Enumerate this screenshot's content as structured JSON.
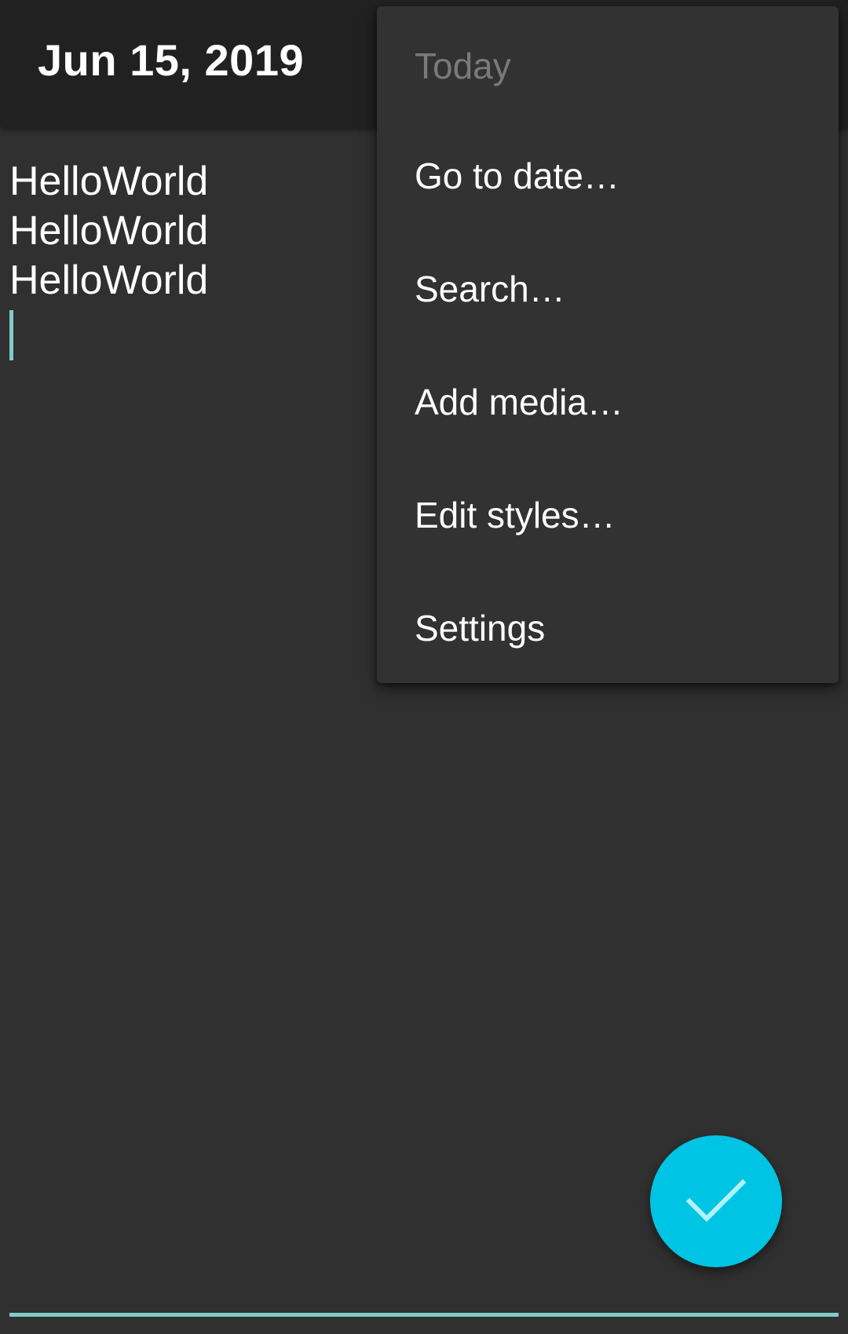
{
  "toolbar": {
    "title": "Jun 15, 2019"
  },
  "editor": {
    "lines": [
      "HelloWorld",
      "HelloWorld",
      "HelloWorld"
    ]
  },
  "menu": {
    "items": [
      {
        "label": "Today",
        "enabled": false
      },
      {
        "label": "Go to date…",
        "enabled": true
      },
      {
        "label": "Search…",
        "enabled": true
      },
      {
        "label": "Add media…",
        "enabled": true
      },
      {
        "label": "Edit styles…",
        "enabled": true
      },
      {
        "label": "Settings",
        "enabled": true
      }
    ]
  },
  "fab": {
    "icon": "check-icon"
  },
  "colors": {
    "background": "#303030",
    "toolbar": "#212121",
    "menu": "#323232",
    "accent": "#00c4e3",
    "cursor": "#80cbc4",
    "disabled_text": "#7a7a7a"
  }
}
